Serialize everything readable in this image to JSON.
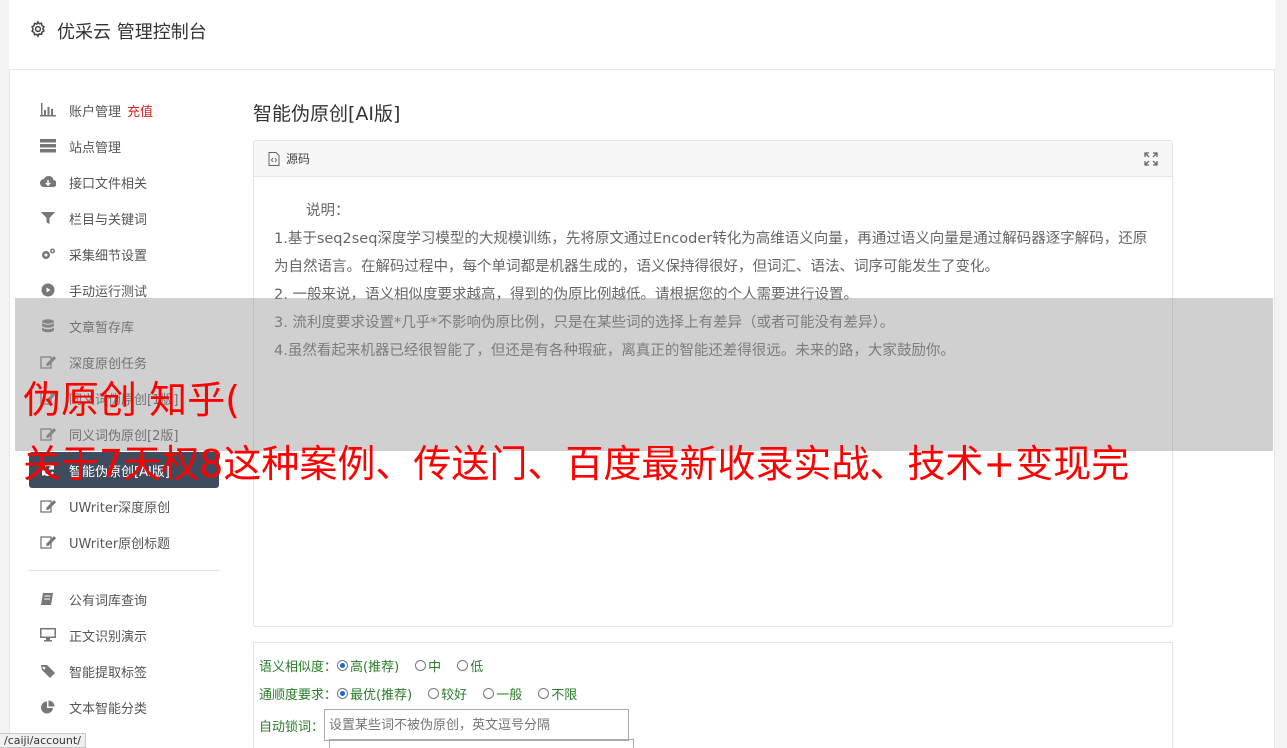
{
  "header": {
    "title": "优采云 管理控制台",
    "icon": "gear-icon"
  },
  "sidebar": {
    "items": [
      {
        "label": "账户管理",
        "badge": "充值",
        "icon": "bar-chart-icon"
      },
      {
        "label": "站点管理",
        "icon": "server-icon"
      },
      {
        "label": "接口文件相关",
        "icon": "cloud-download-icon"
      },
      {
        "label": "栏目与关键词",
        "icon": "filter-icon"
      },
      {
        "label": "采集细节设置",
        "icon": "cogs-icon"
      },
      {
        "label": "手动运行测试",
        "icon": "play-circle-icon"
      },
      {
        "label": "文章暂存库",
        "icon": "database-icon"
      },
      {
        "label": "深度原创任务",
        "icon": "edit-icon"
      },
      {
        "label": "同义词伪原创[1版]",
        "icon": "edit-icon"
      },
      {
        "label": "同义词伪原创[2版]",
        "icon": "edit-icon"
      },
      {
        "label": "智能伪原创[AI版]",
        "icon": "refresh-icon",
        "active": true
      },
      {
        "label": "UWriter深度原创",
        "icon": "edit-icon"
      },
      {
        "label": "UWriter原创标题",
        "icon": "edit-icon"
      }
    ],
    "items2": [
      {
        "label": "公有词库查询",
        "icon": "book-icon"
      },
      {
        "label": "正文识别演示",
        "icon": "desktop-icon"
      },
      {
        "label": "智能提取标签",
        "icon": "tag-icon"
      },
      {
        "label": "文本智能分类",
        "icon": "pie-chart-icon"
      }
    ]
  },
  "main": {
    "title": "智能伪原创[AI版]",
    "panel": {
      "head_label": "源码",
      "lines": [
        "说明：",
        "1.基于seq2seq深度学习模型的大规模训练，先将原文通过Encoder转化为高维语义向量，再通过语义向量是通过解码器逐字解码，还原为自然语言。在解码过程中，每个单词都是机器生成的，语义保持得很好，但词汇、语法、词序可能发生了变化。",
        "2. 一般来说，语义相似度要求越高，得到的伪原比例越低。请根据您的个人需要进行设置。",
        "3. 流利度要求设置*几乎*不影响伪原比例，只是在某些词的选择上有差异（或者可能没有差异）。",
        "4.虽然看起来机器已经很智能了，但还是有各种瑕疵，离真正的智能还差得很远。未来的路，大家鼓励你。"
      ]
    },
    "options": {
      "similarity": {
        "label": "语义相似度：",
        "choices": [
          "高(推荐)",
          "中",
          "低"
        ],
        "selected": 0
      },
      "fluency": {
        "label": "通顺度要求：",
        "choices": [
          "最优(推荐)",
          "较好",
          "一般",
          "不限"
        ],
        "selected": 0
      },
      "lock": {
        "label": "自动锁词：",
        "placeholder": "设置某些词不被伪原创，英文逗号分隔"
      }
    }
  },
  "overlay": {
    "line1": "伪原创 知乎(",
    "line2": "关于7天权8这种案例、传送门、百度最新收录实战、技术+变现完"
  },
  "statusbar": {
    "url": "/caiji/account/"
  }
}
